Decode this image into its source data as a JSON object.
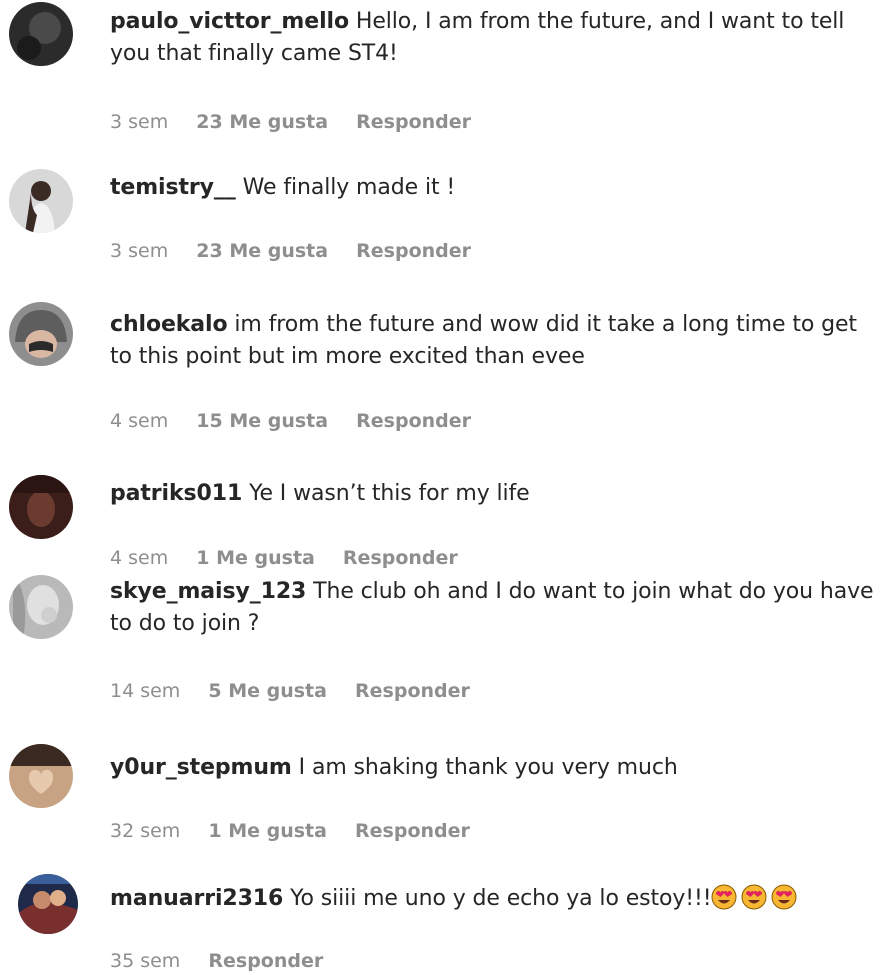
{
  "comments": [
    {
      "username": "paulo_victtor_mello",
      "text": "Hello, I am from the future, and I want to tell you that finally came ST4!",
      "time": "3 sem",
      "likes": "23 Me gusta",
      "reply": "Responder",
      "avatar": "dark-avatar"
    },
    {
      "username": "temistry__",
      "text": "We finally made it !",
      "time": "3 sem",
      "likes": "23 Me gusta",
      "reply": "Responder",
      "avatar": "person-avatar"
    },
    {
      "username": "chloekalo",
      "text": "im from the future and wow did it take a long time to get to this point but im more excited than evee",
      "time": "4 sem",
      "likes": "15 Me gusta",
      "reply": "Responder",
      "avatar": "hooded-avatar"
    },
    {
      "username": "patriks011",
      "text": "Ye I wasn’t this for my life",
      "time": "4 sem",
      "likes": "1 Me gusta",
      "reply": "Responder",
      "avatar": "dark-red-avatar"
    },
    {
      "username": "skye_maisy_123",
      "text": "The club oh and I do want to join what do you have to do to join ?",
      "time": "14 sem",
      "likes": "5 Me gusta",
      "reply": "Responder",
      "avatar": "grey-avatar"
    },
    {
      "username": "y0ur_stepmum",
      "text": "I am shaking thank you very much",
      "time": "32 sem",
      "likes": "1 Me gusta",
      "reply": "Responder",
      "avatar": "heart-hands-avatar"
    },
    {
      "username": "manuarri2316",
      "text": "Yo siiii me uno y de echo ya lo estoy!!!",
      "time": "35 sem",
      "reply": "Responder",
      "emoji_count": 3,
      "emoji_icon": "heart-eyes-emoji-icon",
      "avatar": "colorful-avatar"
    }
  ]
}
